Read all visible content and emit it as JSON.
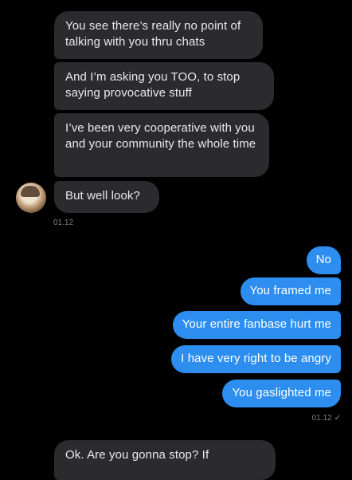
{
  "conversation": {
    "incoming": [
      {
        "text": "You see there’s really no point of talking with you thru chats"
      },
      {
        "text": "And I’m asking you TOO, to stop saying provocative stuff"
      },
      {
        "text": "I’ve been very cooperative with you and your community the whole time"
      },
      {
        "text": "But well look?"
      }
    ],
    "incoming_time": "01.12",
    "outgoing": [
      {
        "text": "No"
      },
      {
        "text": "You framed me"
      },
      {
        "text": "Your entire fanbase hurt me"
      },
      {
        "text": "I have very right to be angry"
      },
      {
        "text": "You gaslighted me"
      }
    ],
    "outgoing_time": "01.12",
    "read_mark": "✓",
    "next_incoming": {
      "text": "Ok. Are you gonna stop? If"
    }
  },
  "colors": {
    "background": "#000000",
    "incoming_bubble": "#2b2b2d",
    "outgoing_bubble": "#2d8ef0"
  },
  "icons": {
    "avatar": "contact-avatar",
    "read": "checkmark-icon"
  }
}
